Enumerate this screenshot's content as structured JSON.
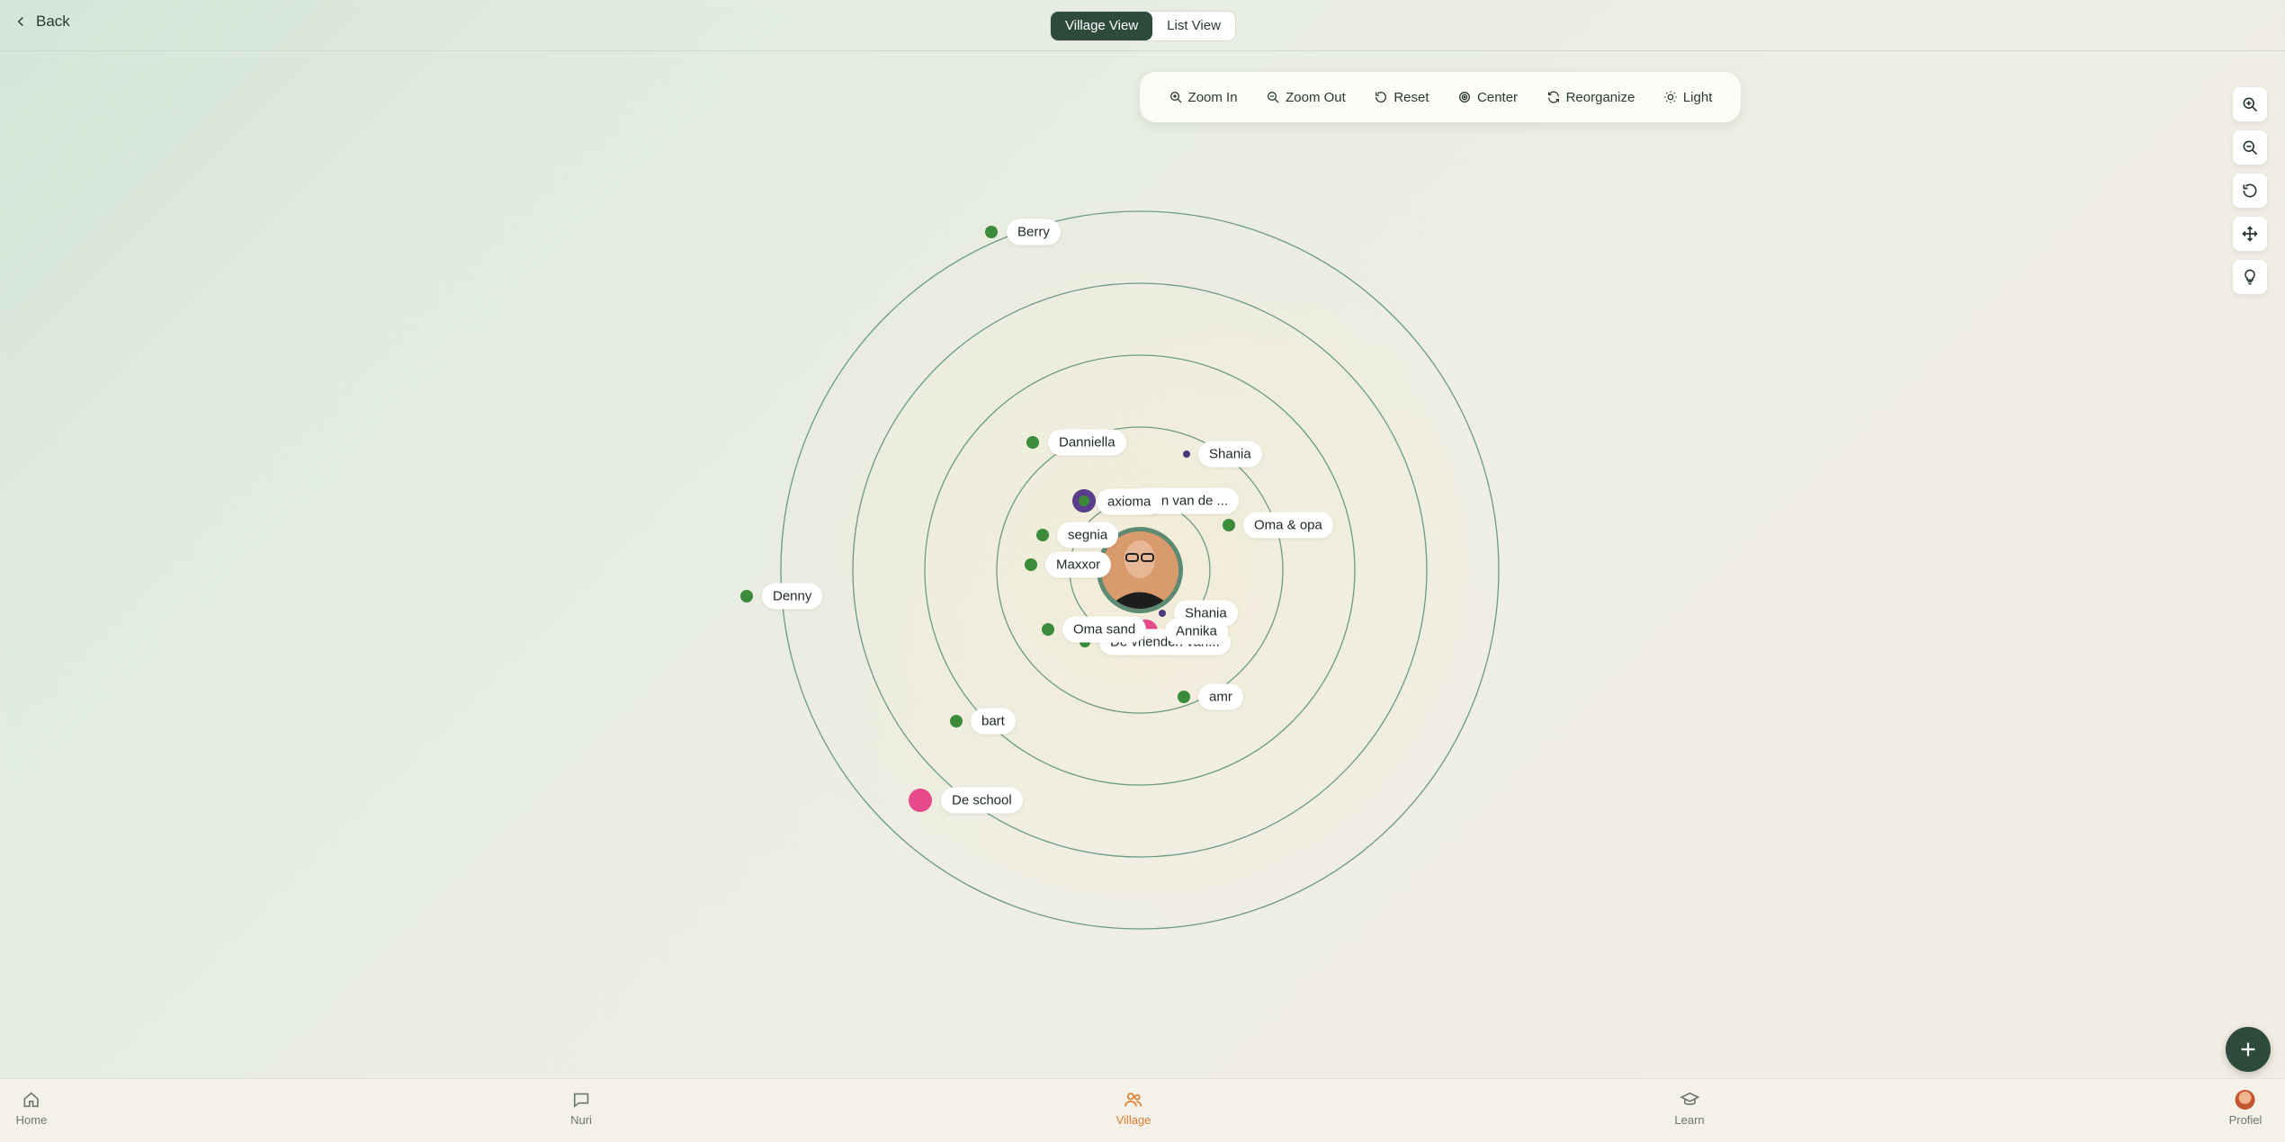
{
  "header": {
    "back_label": "Back",
    "view_toggle": {
      "active": "Village View",
      "inactive": "List View"
    }
  },
  "toolbar": {
    "zoom_in": "Zoom In",
    "zoom_out": "Zoom Out",
    "reset": "Reset",
    "center": "Center",
    "reorganize": "Reorganize",
    "light": "Light"
  },
  "side_controls": [
    "zoom-in-icon",
    "zoom-out-icon",
    "reset-icon",
    "move-icon",
    "lightbulb-icon"
  ],
  "village": {
    "rings": 4,
    "colors": {
      "member": "#3b8b3b",
      "organization": "#e64a8b",
      "group": "#5a3e8c",
      "ring": "#5c8a72"
    },
    "nodes": [
      {
        "label": "Berry",
        "type": "member"
      },
      {
        "label": "Danniella",
        "type": "member"
      },
      {
        "label": "Shania",
        "type": "small"
      },
      {
        "label": "...en van de ...",
        "type": "member"
      },
      {
        "label": "axioma",
        "type": "group"
      },
      {
        "label": "Oma & opa",
        "type": "member"
      },
      {
        "label": "segnia",
        "type": "member"
      },
      {
        "label": "Maxxor",
        "type": "member"
      },
      {
        "label": "Denny",
        "type": "member"
      },
      {
        "label": "De vrienden van...",
        "type": "member"
      },
      {
        "label": "Oma sand",
        "type": "member"
      },
      {
        "label": "Shania",
        "type": "small"
      },
      {
        "label": "Annika",
        "type": "organization"
      },
      {
        "label": "amr",
        "type": "member"
      },
      {
        "label": "bart",
        "type": "member"
      },
      {
        "label": "De school",
        "type": "organization"
      }
    ]
  },
  "bottom_nav": [
    {
      "label": "Home",
      "icon": "home-icon"
    },
    {
      "label": "Nuri",
      "icon": "chat-icon"
    },
    {
      "label": "Village",
      "icon": "people-icon",
      "active": true
    },
    {
      "label": "Learn",
      "icon": "graduation-cap-icon"
    },
    {
      "label": "Profiel",
      "icon": "avatar"
    }
  ]
}
